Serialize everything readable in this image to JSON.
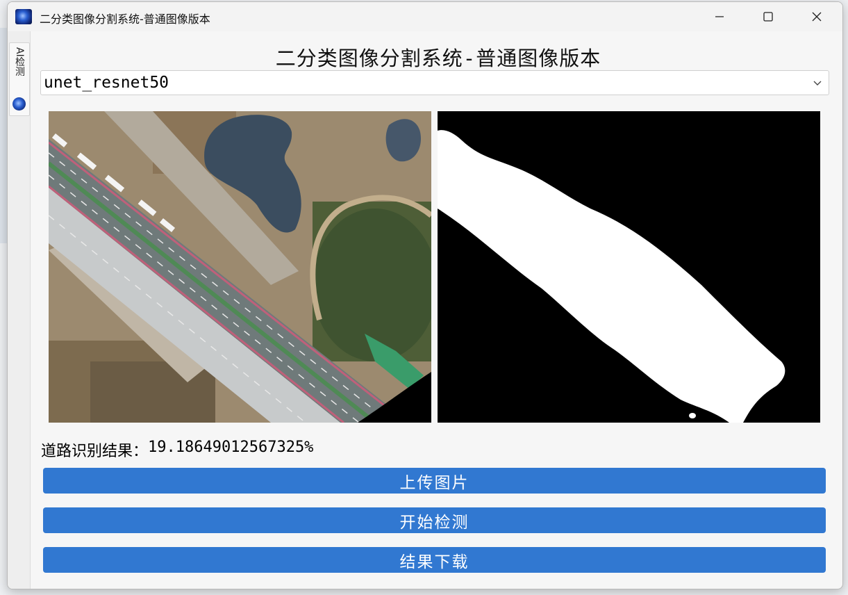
{
  "window": {
    "title": "二分类图像分割系统-普通图像版本"
  },
  "side_tab": {
    "label": "AI检测"
  },
  "app": {
    "heading": "二分类图像分割系统-普通图像版本",
    "model_select": {
      "selected": "unet_resnet50"
    },
    "images": {
      "original_icon": "aerial-road-photo",
      "mask_icon": "segmentation-mask"
    },
    "result": {
      "label": "道路识别结果：",
      "value": "19.18649012567325%"
    },
    "buttons": {
      "upload": "上传图片",
      "detect": "开始检测",
      "download": "结果下载"
    }
  },
  "colors": {
    "accent": "#3178d1",
    "mask_foreground": "#ffffff",
    "mask_background": "#000000"
  }
}
